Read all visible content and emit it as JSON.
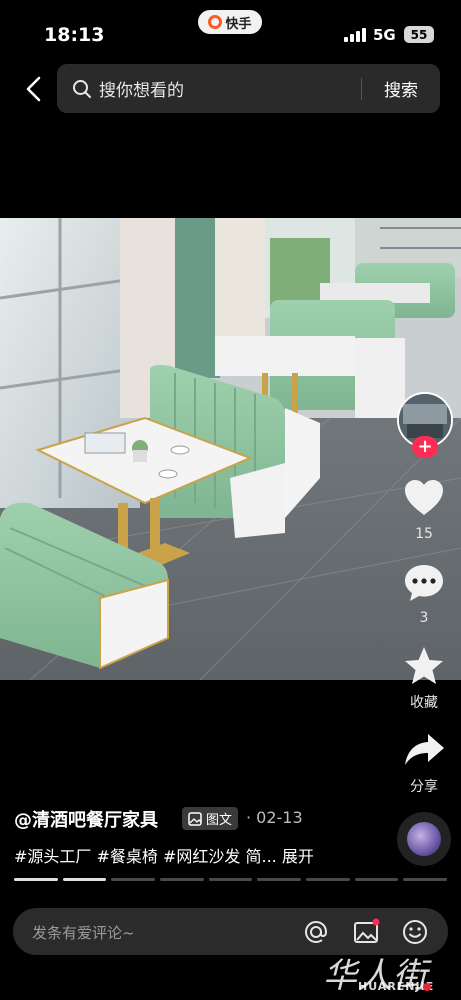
{
  "status_bar": {
    "time": "18:13",
    "app_name": "快手",
    "network": "5G",
    "battery": "55"
  },
  "search": {
    "placeholder": "搜你想看的",
    "button_label": "搜索"
  },
  "post_image": {
    "description_icon": "restaurant-booth-photo"
  },
  "right_rail": {
    "like_count": "15",
    "comment_count": "3",
    "favorite_label": "收藏",
    "share_label": "分享"
  },
  "caption": {
    "author": "@清酒吧餐厅家具",
    "type_badge": "图文",
    "date": "· 02-13",
    "hashtags": "#源头工厂 #餐桌椅 #网红沙发 简... 展开"
  },
  "progress": {
    "total_pages": 9,
    "current_page": 2
  },
  "comment_bar": {
    "placeholder": "发条有爱评论~"
  },
  "watermark": {
    "chinese": "华人街",
    "english": "HUARENJIE"
  },
  "colors": {
    "accent_red": "#fe2c55",
    "booth_green": "#8fc4a0",
    "brand_orange": "#ff5a1f"
  }
}
